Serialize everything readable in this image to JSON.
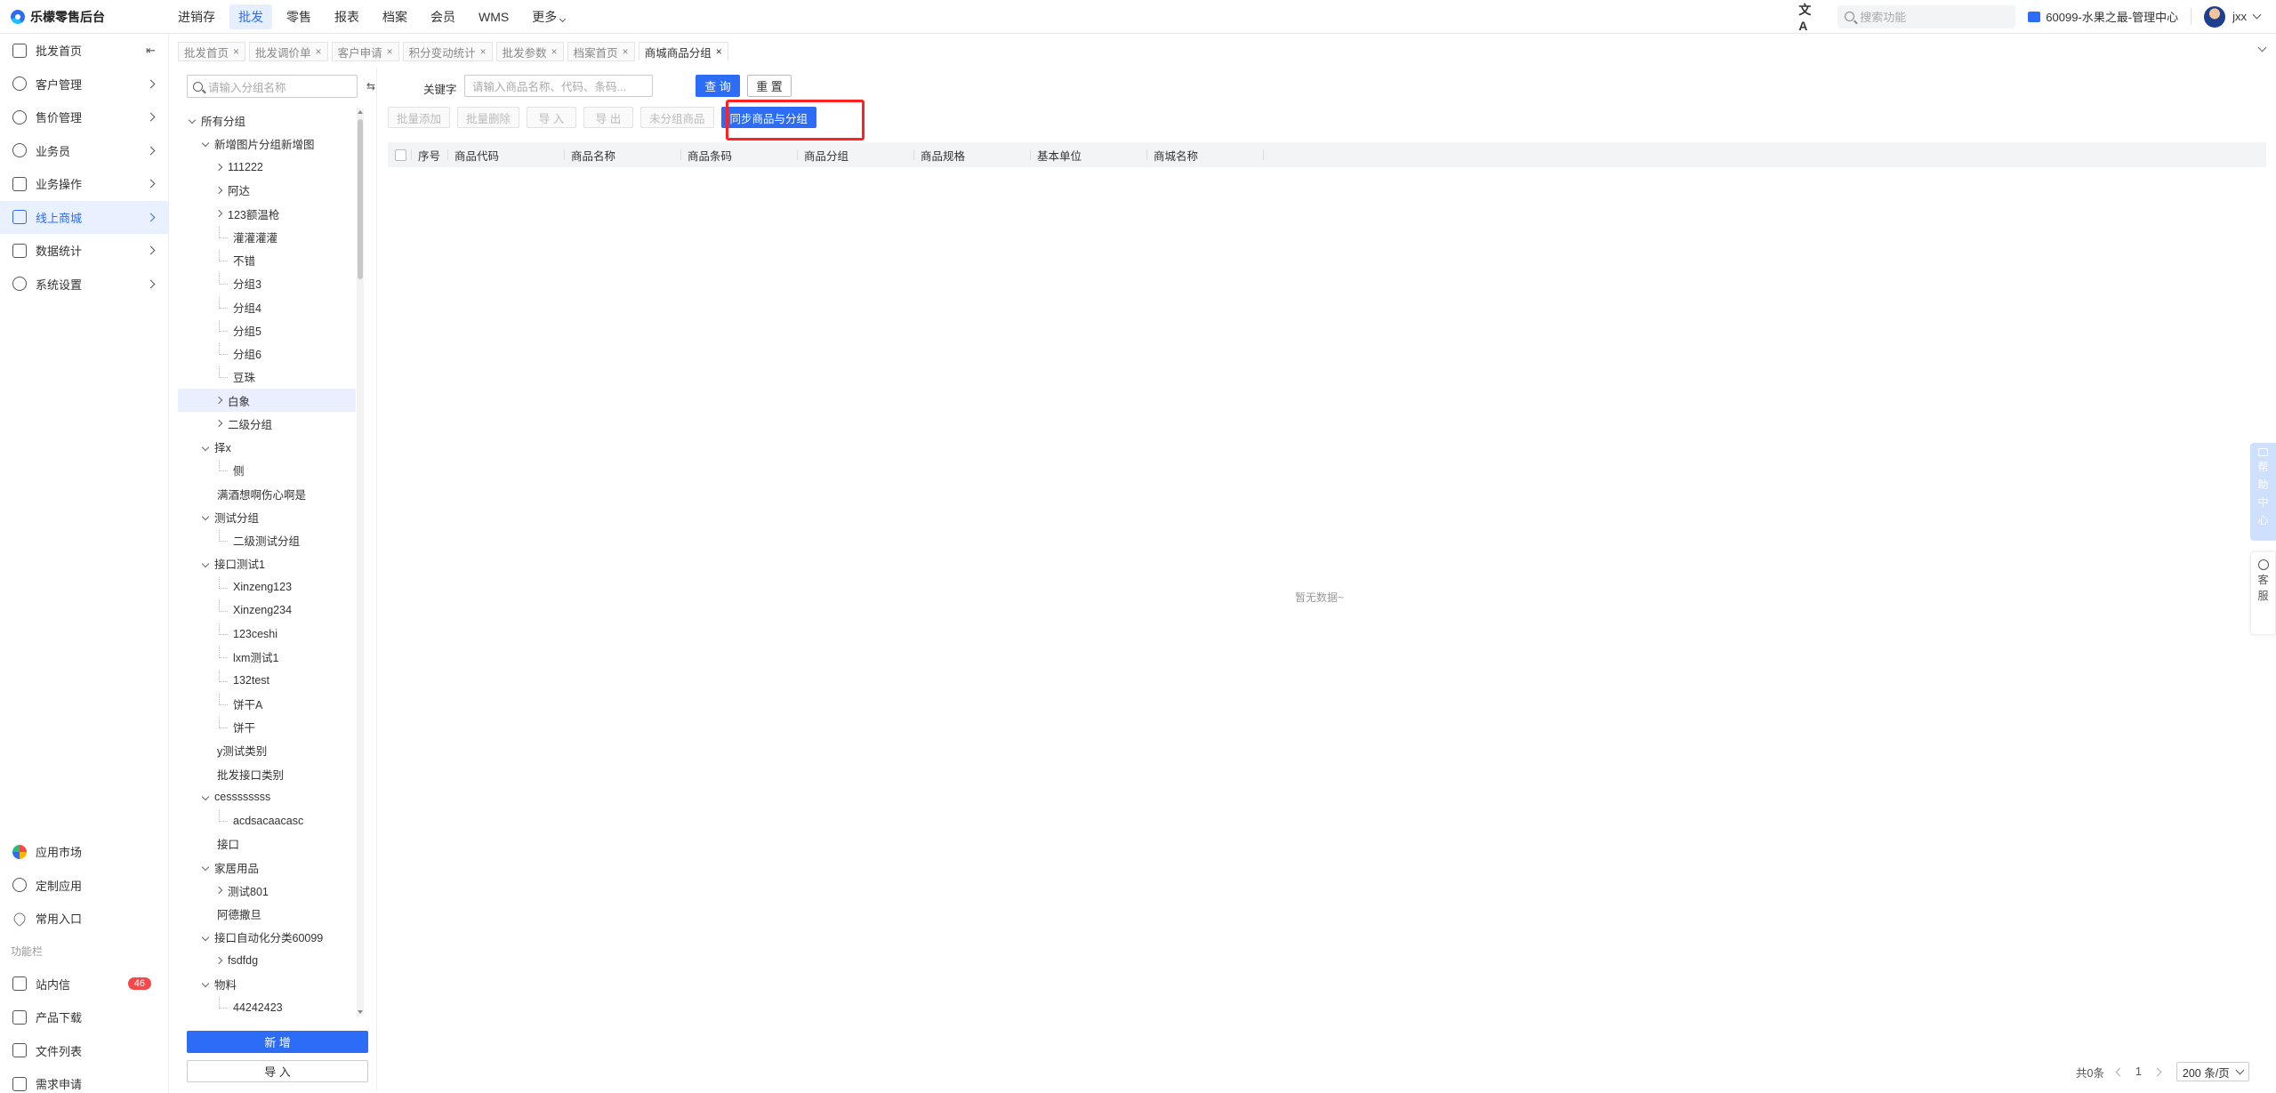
{
  "app": {
    "brand": "乐檬零售后台"
  },
  "topnav": [
    {
      "label": "进销存",
      "active": false
    },
    {
      "label": "批发",
      "active": true
    },
    {
      "label": "零售",
      "active": false
    },
    {
      "label": "报表",
      "active": false
    },
    {
      "label": "档案",
      "active": false
    },
    {
      "label": "会员",
      "active": false
    },
    {
      "label": "WMS",
      "active": false
    },
    {
      "label": "更多",
      "active": false
    }
  ],
  "header": {
    "search_placeholder": "搜索功能",
    "store": "60099-水果之最-管理中心",
    "user": "jxx"
  },
  "sidebar": {
    "items": [
      {
        "label": "批发首页"
      },
      {
        "label": "客户管理"
      },
      {
        "label": "售价管理"
      },
      {
        "label": "业务员"
      },
      {
        "label": "业务操作"
      },
      {
        "label": "线上商城"
      },
      {
        "label": "数据统计"
      },
      {
        "label": "系统设置"
      }
    ],
    "bottom": [
      {
        "label": "应用市场"
      },
      {
        "label": "定制应用"
      },
      {
        "label": "常用入口"
      }
    ],
    "group_label": "功能栏",
    "func": [
      {
        "label": "站内信",
        "badge": "46"
      },
      {
        "label": "产品下载"
      },
      {
        "label": "文件列表"
      },
      {
        "label": "需求申请"
      }
    ]
  },
  "tabs": [
    {
      "label": "批发首页"
    },
    {
      "label": "批发调价单"
    },
    {
      "label": "客户申请"
    },
    {
      "label": "积分变动统计"
    },
    {
      "label": "批发参数"
    },
    {
      "label": "档案首页"
    },
    {
      "label": "商城商品分组"
    }
  ],
  "tree": {
    "search_placeholder": "请输入分组名称",
    "nodes": [
      {
        "label": "所有分组"
      },
      {
        "label": "新增图片分组新增图"
      },
      {
        "label": "111222"
      },
      {
        "label": "阿达"
      },
      {
        "label": "123额温枪"
      },
      {
        "label": "灌灌灌灌"
      },
      {
        "label": "不错"
      },
      {
        "label": "分组3"
      },
      {
        "label": "分组4"
      },
      {
        "label": "分组5"
      },
      {
        "label": "分组6"
      },
      {
        "label": "豆珠"
      },
      {
        "label": "白象"
      },
      {
        "label": "二级分组"
      },
      {
        "label": "择x"
      },
      {
        "label": "侧"
      },
      {
        "label": "满酒想啊伤心啊是"
      },
      {
        "label": "测试分组"
      },
      {
        "label": "二级测试分组"
      },
      {
        "label": "接口测试1"
      },
      {
        "label": "Xinzeng123"
      },
      {
        "label": "Xinzeng234"
      },
      {
        "label": "123ceshi"
      },
      {
        "label": "lxm测试1"
      },
      {
        "label": "132test"
      },
      {
        "label": "饼干A"
      },
      {
        "label": "饼干"
      },
      {
        "label": "y测试类别"
      },
      {
        "label": "批发接口类别"
      },
      {
        "label": "cessssssss"
      },
      {
        "label": "acdsacaacasc"
      },
      {
        "label": "接口"
      },
      {
        "label": "家居用品"
      },
      {
        "label": "测试801"
      },
      {
        "label": "阿德撒旦"
      },
      {
        "label": "接口自动化分类60099"
      },
      {
        "label": "fsdfdg"
      },
      {
        "label": "物料"
      },
      {
        "label": "44242423"
      }
    ],
    "new_button": "新 增",
    "import_button": "导 入"
  },
  "filter": {
    "keyword_label": "关键字",
    "keyword_placeholder": "请输入商品名称、代码、条码...",
    "query": "查 询",
    "reset": "重 置"
  },
  "toolbar": {
    "batch_add": "批量添加",
    "batch_delete": "批量删除",
    "import": "导 入",
    "export": "导 出",
    "ungrouped": "未分组商品",
    "sync": "同步商品与分组"
  },
  "table": {
    "columns": [
      "序号",
      "商品代码",
      "商品名称",
      "商品条码",
      "商品分组",
      "商品规格",
      "基本单位",
      "商城名称"
    ],
    "empty_text": "暂无数据~"
  },
  "pagination": {
    "total": "共0条",
    "page": "1",
    "page_size": "200 条/页"
  },
  "float": {
    "help": [
      "帮",
      "助",
      "中",
      "心"
    ],
    "service": [
      "客",
      "服"
    ]
  },
  "colors": {
    "accent": "#2d6cf6",
    "highlight": "#ff2222",
    "badge": "#f5484a"
  }
}
